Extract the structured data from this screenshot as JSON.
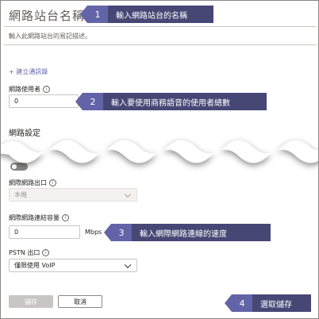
{
  "form": {
    "site_name": "網路站台名稱",
    "description_placeholder": "輸入此網路站台的易記描述。",
    "add_address_link": "+ 建立通訊錄",
    "network_users_label": "網路使用者",
    "network_users_value": "0",
    "network_settings_title": "網路設定",
    "internet_egress_label": "網際網路出口",
    "internet_egress_value": "本機",
    "internet_capacity_label": "網際網路連結容量",
    "internet_capacity_value": "0",
    "capacity_unit": "Mbps",
    "pstn_egress_label": "PSTN 出口",
    "pstn_egress_value": "僅限使用 VoIP",
    "save_label": "儲存",
    "cancel_label": "取消"
  },
  "callouts": [
    {
      "number": "1",
      "text": "輸入網路站台的名稱"
    },
    {
      "number": "2",
      "text": "輸入要使用商務語音的使用者總數"
    },
    {
      "number": "3",
      "text": "輸入網際網路連線的速度"
    },
    {
      "number": "4",
      "text": "選取儲存"
    }
  ],
  "icons": {
    "info": "info-icon",
    "chevron": "chevron-down-icon"
  },
  "colors": {
    "callout_dark": "#464775",
    "callout_number": "#6264a7",
    "link": "#6264a7",
    "save_disabled": "#c8c6c4"
  }
}
